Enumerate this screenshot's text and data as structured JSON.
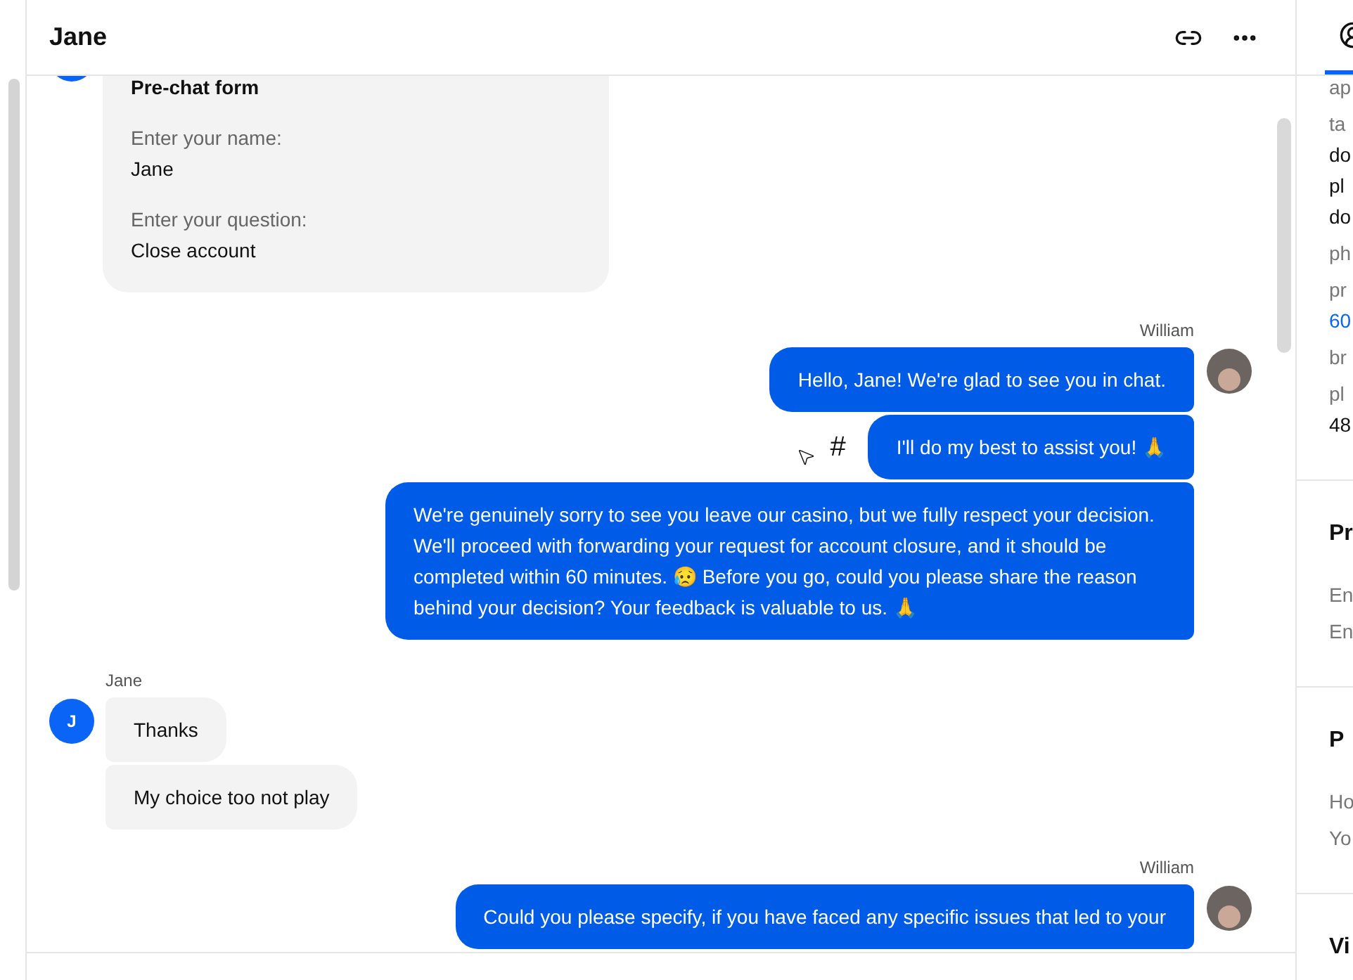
{
  "header": {
    "title": "Jane"
  },
  "prechat_form": {
    "title": "Pre-chat form",
    "fields": [
      {
        "label": "Enter your name:",
        "value": "Jane"
      },
      {
        "label": "Enter your question:",
        "value": "Close account"
      }
    ]
  },
  "groups": [
    {
      "author": "William",
      "kind": "agent",
      "avatar": {
        "kind": "photo"
      },
      "messages": [
        {
          "text": "Hello, Jane! We're glad to see you in chat."
        },
        {
          "text": "I'll do my best to assist you! 🙏",
          "mark": "#"
        },
        {
          "text": "We're genuinely sorry to see you leave our casino, but we fully respect your decision. We'll proceed with forwarding your request for account closure, and it should be completed within 60 minutes. 😥 Before you go, could you please share the reason behind your decision? Your feedback is valuable to us. 🙏"
        }
      ]
    },
    {
      "author": "Jane",
      "kind": "visitor",
      "avatar": {
        "kind": "letter",
        "text": "J"
      },
      "messages": [
        {
          "text": "Thanks"
        },
        {
          "text": "My choice too not play"
        }
      ]
    },
    {
      "author": "William",
      "kind": "agent",
      "avatar": {
        "kind": "photo"
      },
      "messages": [
        {
          "text": "Could you please specify, if you have faced any specific issues that led to your"
        }
      ]
    }
  ],
  "right_panel": {
    "tab": {
      "selected": true
    },
    "sections": [
      {
        "rows": [
          {
            "kind": "label",
            "text": "ap"
          },
          {
            "kind": "label",
            "text": "ta"
          },
          {
            "kind": "value",
            "text": "do"
          },
          {
            "kind": "value",
            "text": "pl"
          },
          {
            "kind": "value",
            "text": "do"
          },
          {
            "kind": "label",
            "text": "ph"
          },
          {
            "kind": "label",
            "text": "pr"
          },
          {
            "kind": "link",
            "text": "60"
          },
          {
            "kind": "label",
            "text": "br"
          },
          {
            "kind": "label",
            "text": "pl"
          },
          {
            "kind": "value",
            "text": "48"
          }
        ]
      },
      {
        "heading": "Pr",
        "rows": [
          {
            "kind": "label",
            "text": "En"
          },
          {
            "kind": "label",
            "text": "En"
          }
        ]
      },
      {
        "heading": "P",
        "rows": [
          {
            "kind": "label",
            "text": "Ho"
          },
          {
            "kind": "label",
            "text": "Yo"
          }
        ]
      },
      {
        "heading": "Vi"
      }
    ]
  }
}
